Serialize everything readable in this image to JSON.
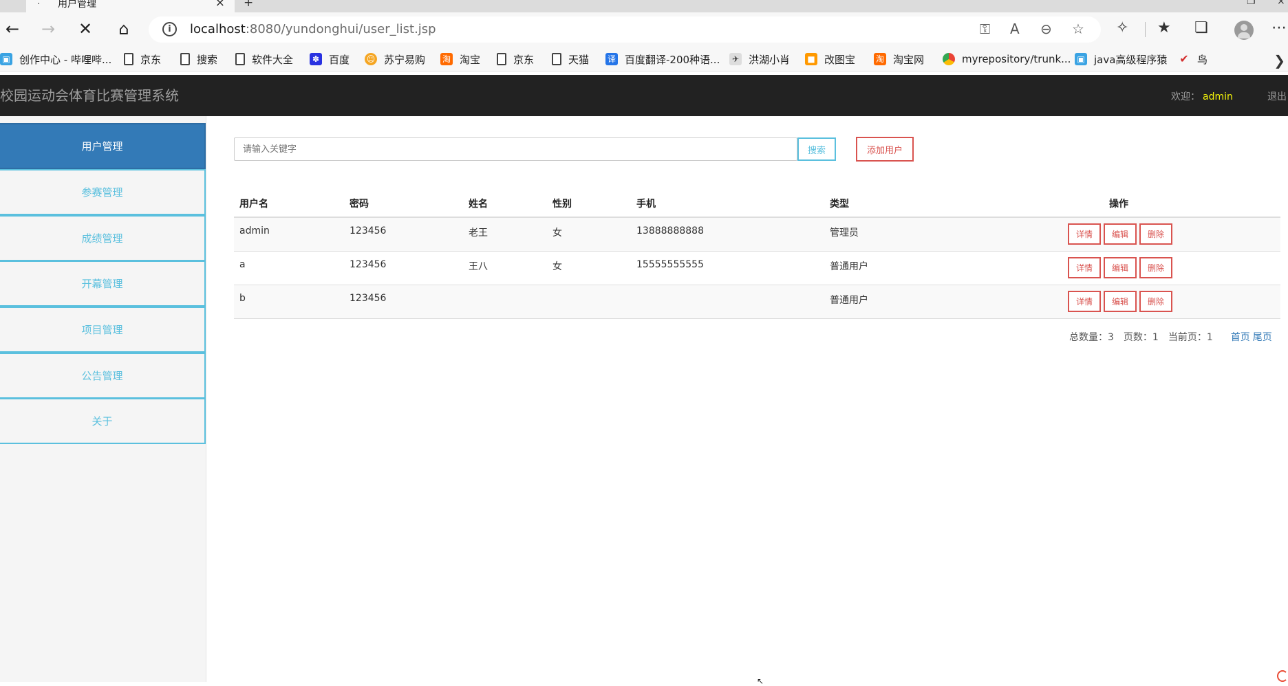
{
  "browser": {
    "tab_title": "用户管理",
    "url_host": "localhost",
    "url_rest": ":8080/yundonghui/user_list.jsp",
    "bookmarks": [
      {
        "label": "创作中心 - 哔哩哔...",
        "icon": "bilibili-icon"
      },
      {
        "label": "京东",
        "icon": "page-icon"
      },
      {
        "label": "搜索",
        "icon": "page-icon"
      },
      {
        "label": "软件大全",
        "icon": "page-icon"
      },
      {
        "label": "百度",
        "icon": "baidu-paw-icon"
      },
      {
        "label": "苏宁易购",
        "icon": "suning-lion-icon"
      },
      {
        "label": "淘宝",
        "icon": "taobao-icon"
      },
      {
        "label": "京东",
        "icon": "page-icon"
      },
      {
        "label": "天猫",
        "icon": "page-icon"
      },
      {
        "label": "百度翻译-200种语...",
        "icon": "translate-icon"
      },
      {
        "label": "洪湖小肖",
        "icon": "bird-icon"
      },
      {
        "label": "改图宝",
        "icon": "orange-square-icon"
      },
      {
        "label": "淘宝网",
        "icon": "taobao-icon"
      },
      {
        "label": "myrepository/trunk...",
        "icon": "chrome-icon"
      },
      {
        "label": "java高级程序猿",
        "icon": "bilibili-icon"
      },
      {
        "label": "鸟",
        "icon": "red-bird-icon"
      }
    ]
  },
  "app": {
    "title": "校园运动会体育比赛管理系统",
    "welcome_label": "欢迎：",
    "username": "admin",
    "logout": "退出"
  },
  "sidebar": {
    "items": [
      {
        "label": "用户管理",
        "active": true
      },
      {
        "label": "参赛管理",
        "active": false
      },
      {
        "label": "成绩管理",
        "active": false
      },
      {
        "label": "开幕管理",
        "active": false
      },
      {
        "label": "项目管理",
        "active": false
      },
      {
        "label": "公告管理",
        "active": false
      },
      {
        "label": "关于",
        "active": false
      }
    ]
  },
  "search": {
    "placeholder": "请输入关键字",
    "button": "搜索",
    "add_button": "添加用户"
  },
  "table": {
    "headers": [
      "用户名",
      "密码",
      "姓名",
      "性别",
      "手机",
      "类型",
      "操作"
    ],
    "actions": [
      "详情",
      "编辑",
      "删除"
    ],
    "rows": [
      {
        "username": "admin",
        "password": "123456",
        "name": "老王",
        "gender": "女",
        "phone": "13888888888",
        "type": "管理员"
      },
      {
        "username": "a",
        "password": "123456",
        "name": "王八",
        "gender": "女",
        "phone": "15555555555",
        "type": "普通用户"
      },
      {
        "username": "b",
        "password": "123456",
        "name": "",
        "gender": "",
        "phone": "",
        "type": "普通用户"
      }
    ]
  },
  "pager": {
    "total": "总数量：3",
    "pages": "页数：1",
    "current": "当前页：1",
    "first": "首页",
    "last": "尾页"
  },
  "colors": {
    "primary": "#337ab7",
    "info": "#5bc0de",
    "danger": "#d9534f",
    "navbar": "#222222",
    "username_highlight": "#f3f30a"
  }
}
